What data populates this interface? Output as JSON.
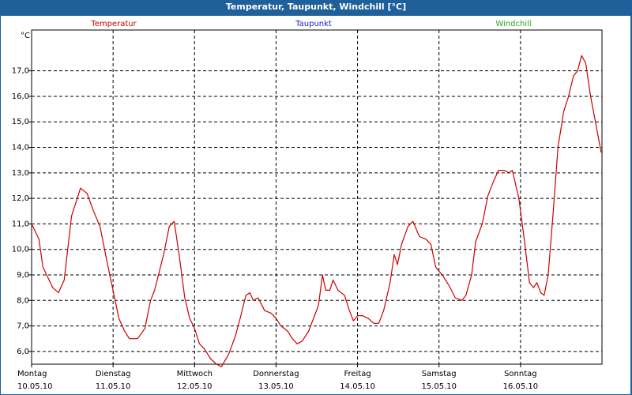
{
  "window": {
    "title": "Temperatur, Taupunkt, Windchill [°C]"
  },
  "colors": {
    "temperature": "#cc0000",
    "dewpoint": "#1a1acc",
    "windchill": "#22aa22",
    "grid": "#000000",
    "axis": "#000000"
  },
  "chart_data": {
    "type": "line",
    "title": "Temperatur, Taupunkt, Windchill [°C]",
    "ylabel": "°C",
    "ylim": [
      5.5,
      18.6
    ],
    "yticks": [
      "6,0",
      "7,0",
      "8,0",
      "9,0",
      "10,0",
      "11,0",
      "12,0",
      "13,0",
      "14,0",
      "15,0",
      "16,0",
      "17,0"
    ],
    "x_unit": "days from Montag 10.05.10 00:00",
    "xlim": [
      0,
      7
    ],
    "grid": true,
    "legend": [
      {
        "name": "Temperatur",
        "color": "#cc0000",
        "position": "top-left"
      },
      {
        "name": "Taupunkt",
        "color": "#1a1acc",
        "position": "top-center"
      },
      {
        "name": "Windchill",
        "color": "#22aa22",
        "position": "top-right"
      }
    ],
    "x_labels": [
      {
        "day": "Montag",
        "date": "10.05.10"
      },
      {
        "day": "Dienstag",
        "date": "11.05.10"
      },
      {
        "day": "Mittwoch",
        "date": "12.05.10"
      },
      {
        "day": "Donnerstag",
        "date": "13.05.10"
      },
      {
        "day": "Freitag",
        "date": "14.05.10"
      },
      {
        "day": "Samstag",
        "date": "15.05.10"
      },
      {
        "day": "Sonntag",
        "date": "16.05.10"
      }
    ],
    "series": [
      {
        "name": "Temperatur",
        "color": "#cc0000",
        "points": [
          [
            0.0,
            11.0
          ],
          [
            0.09,
            10.4
          ],
          [
            0.14,
            9.3
          ],
          [
            0.2,
            8.9
          ],
          [
            0.26,
            8.5
          ],
          [
            0.33,
            8.3
          ],
          [
            0.4,
            8.8
          ],
          [
            0.49,
            11.3
          ],
          [
            0.6,
            12.4
          ],
          [
            0.68,
            12.2
          ],
          [
            0.76,
            11.5
          ],
          [
            0.84,
            10.9
          ],
          [
            0.92,
            9.6
          ],
          [
            1.0,
            8.4
          ],
          [
            1.07,
            7.3
          ],
          [
            1.14,
            6.8
          ],
          [
            1.2,
            6.5
          ],
          [
            1.3,
            6.5
          ],
          [
            1.39,
            6.9
          ],
          [
            1.46,
            8.0
          ],
          [
            1.51,
            8.4
          ],
          [
            1.62,
            9.8
          ],
          [
            1.69,
            10.9
          ],
          [
            1.75,
            11.1
          ],
          [
            1.81,
            9.8
          ],
          [
            1.88,
            8.1
          ],
          [
            1.94,
            7.3
          ],
          [
            2.0,
            6.9
          ],
          [
            2.06,
            6.3
          ],
          [
            2.12,
            6.1
          ],
          [
            2.2,
            5.7
          ],
          [
            2.27,
            5.5
          ],
          [
            2.33,
            5.4
          ],
          [
            2.42,
            5.9
          ],
          [
            2.5,
            6.6
          ],
          [
            2.56,
            7.3
          ],
          [
            2.63,
            8.2
          ],
          [
            2.68,
            8.3
          ],
          [
            2.72,
            8.0
          ],
          [
            2.78,
            8.1
          ],
          [
            2.86,
            7.6
          ],
          [
            2.94,
            7.5
          ],
          [
            3.0,
            7.3
          ],
          [
            3.06,
            7.0
          ],
          [
            3.14,
            6.8
          ],
          [
            3.2,
            6.5
          ],
          [
            3.26,
            6.3
          ],
          [
            3.32,
            6.4
          ],
          [
            3.4,
            6.8
          ],
          [
            3.46,
            7.3
          ],
          [
            3.52,
            7.8
          ],
          [
            3.57,
            9.0
          ],
          [
            3.61,
            8.4
          ],
          [
            3.66,
            8.4
          ],
          [
            3.7,
            8.8
          ],
          [
            3.76,
            8.4
          ],
          [
            3.84,
            8.2
          ],
          [
            3.9,
            7.6
          ],
          [
            3.95,
            7.2
          ],
          [
            4.0,
            7.4
          ],
          [
            4.06,
            7.4
          ],
          [
            4.13,
            7.3
          ],
          [
            4.2,
            7.1
          ],
          [
            4.26,
            7.1
          ],
          [
            4.32,
            7.6
          ],
          [
            4.4,
            8.7
          ],
          [
            4.45,
            9.8
          ],
          [
            4.49,
            9.4
          ],
          [
            4.54,
            10.2
          ],
          [
            4.62,
            10.9
          ],
          [
            4.68,
            11.1
          ],
          [
            4.76,
            10.5
          ],
          [
            4.84,
            10.4
          ],
          [
            4.9,
            10.2
          ],
          [
            4.96,
            9.3
          ],
          [
            5.04,
            9.0
          ],
          [
            5.12,
            8.6
          ],
          [
            5.2,
            8.1
          ],
          [
            5.28,
            8.0
          ],
          [
            5.33,
            8.2
          ],
          [
            5.4,
            9.0
          ],
          [
            5.45,
            10.3
          ],
          [
            5.53,
            11.0
          ],
          [
            5.6,
            12.1
          ],
          [
            5.66,
            12.6
          ],
          [
            5.73,
            13.1
          ],
          [
            5.8,
            13.1
          ],
          [
            5.86,
            13.0
          ],
          [
            5.9,
            13.1
          ],
          [
            5.98,
            12.0
          ],
          [
            6.05,
            10.3
          ],
          [
            6.11,
            8.7
          ],
          [
            6.16,
            8.5
          ],
          [
            6.2,
            8.7
          ],
          [
            6.25,
            8.3
          ],
          [
            6.29,
            8.2
          ],
          [
            6.34,
            9.0
          ],
          [
            6.4,
            11.4
          ],
          [
            6.46,
            14.0
          ],
          [
            6.53,
            15.4
          ],
          [
            6.59,
            16.0
          ],
          [
            6.65,
            16.8
          ],
          [
            6.7,
            17.0
          ],
          [
            6.75,
            17.6
          ],
          [
            6.8,
            17.3
          ],
          [
            6.86,
            16.0
          ],
          [
            6.92,
            15.0
          ],
          [
            6.99,
            13.8
          ]
        ]
      }
    ]
  }
}
